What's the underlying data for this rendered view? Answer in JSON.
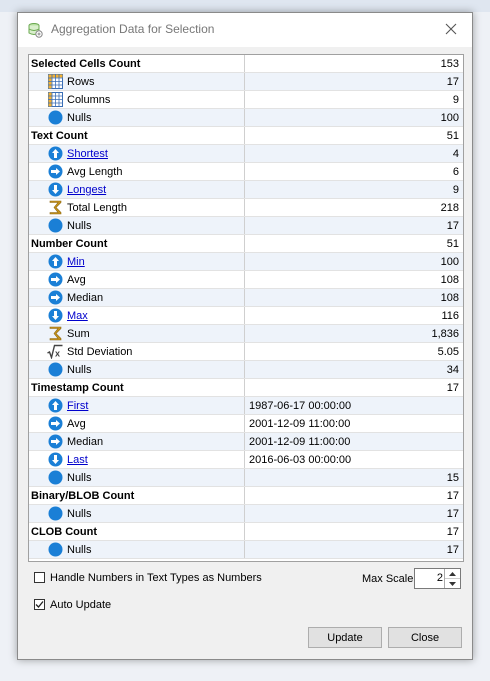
{
  "window": {
    "title": "Aggregation Data for Selection"
  },
  "rows": [
    {
      "type": "header",
      "label": "Selected Cells Count",
      "value": "153",
      "align": "num"
    },
    {
      "type": "item",
      "icon": "rows-grid-icon",
      "label": "Rows",
      "link": false,
      "value": "17",
      "align": "num"
    },
    {
      "type": "item",
      "icon": "columns-grid-icon",
      "label": "Columns",
      "link": false,
      "value": "9",
      "align": "num"
    },
    {
      "type": "item",
      "icon": "null-circle-icon",
      "label": "Nulls",
      "link": false,
      "value": "100",
      "align": "num"
    },
    {
      "type": "header",
      "label": "Text Count",
      "value": "51",
      "align": "num"
    },
    {
      "type": "item",
      "icon": "arrow-up-icon",
      "label": "Shortest",
      "link": true,
      "value": "4",
      "align": "num"
    },
    {
      "type": "item",
      "icon": "arrow-right-icon",
      "label": "Avg Length",
      "link": false,
      "value": "6",
      "align": "num"
    },
    {
      "type": "item",
      "icon": "arrow-down-icon",
      "label": "Longest",
      "link": true,
      "value": "9",
      "align": "num"
    },
    {
      "type": "item",
      "icon": "sigma-icon",
      "label": "Total Length",
      "link": false,
      "value": "218",
      "align": "num"
    },
    {
      "type": "item",
      "icon": "null-circle-icon",
      "label": "Nulls",
      "link": false,
      "value": "17",
      "align": "num"
    },
    {
      "type": "header",
      "label": "Number Count",
      "value": "51",
      "align": "num"
    },
    {
      "type": "item",
      "icon": "arrow-up-icon",
      "label": "Min",
      "link": true,
      "value": "100",
      "align": "num"
    },
    {
      "type": "item",
      "icon": "arrow-right-icon",
      "label": "Avg",
      "link": false,
      "value": "108",
      "align": "num"
    },
    {
      "type": "item",
      "icon": "arrow-right-icon",
      "label": "Median",
      "link": false,
      "value": "108",
      "align": "num"
    },
    {
      "type": "item",
      "icon": "arrow-down-icon",
      "label": "Max",
      "link": true,
      "value": "116",
      "align": "num"
    },
    {
      "type": "item",
      "icon": "sigma-icon",
      "label": "Sum",
      "link": false,
      "value": "1,836",
      "align": "num"
    },
    {
      "type": "item",
      "icon": "sqrt-icon",
      "label": "Std Deviation",
      "link": false,
      "value": "5.05",
      "align": "num"
    },
    {
      "type": "item",
      "icon": "null-circle-icon",
      "label": "Nulls",
      "link": false,
      "value": "34",
      "align": "num"
    },
    {
      "type": "header",
      "label": "Timestamp Count",
      "value": "17",
      "align": "num"
    },
    {
      "type": "item",
      "icon": "arrow-up-icon",
      "label": "First",
      "link": true,
      "value": "1987-06-17 00:00:00",
      "align": "txt"
    },
    {
      "type": "item",
      "icon": "arrow-right-icon",
      "label": "Avg",
      "link": false,
      "value": "2001-12-09 11:00:00",
      "align": "txt"
    },
    {
      "type": "item",
      "icon": "arrow-right-icon",
      "label": "Median",
      "link": false,
      "value": "2001-12-09 11:00:00",
      "align": "txt"
    },
    {
      "type": "item",
      "icon": "arrow-down-icon",
      "label": "Last",
      "link": true,
      "value": "2016-06-03 00:00:00",
      "align": "txt"
    },
    {
      "type": "item",
      "icon": "null-circle-icon",
      "label": "Nulls",
      "link": false,
      "value": "15",
      "align": "num"
    },
    {
      "type": "header",
      "label": "Binary/BLOB Count",
      "value": "17",
      "align": "num"
    },
    {
      "type": "item",
      "icon": "null-circle-icon",
      "label": "Nulls",
      "link": false,
      "value": "17",
      "align": "num"
    },
    {
      "type": "header",
      "label": "CLOB Count",
      "value": "17",
      "align": "num"
    },
    {
      "type": "item",
      "icon": "null-circle-icon",
      "label": "Nulls",
      "link": false,
      "value": "17",
      "align": "num"
    }
  ],
  "options": {
    "handle_numbers_label": "Handle Numbers in Text Types as Numbers",
    "handle_numbers_checked": false,
    "auto_update_label": "Auto Update",
    "auto_update_checked": true,
    "max_scale_label": "Max Scale",
    "max_scale_value": "2"
  },
  "buttons": {
    "update_label": "Update",
    "close_label": "Close"
  },
  "colors": {
    "icon_blue": "#1a7fd6",
    "link_blue": "#0000cc",
    "sigma_gold": "#c8951e",
    "alt_row": "#eef3fa"
  }
}
